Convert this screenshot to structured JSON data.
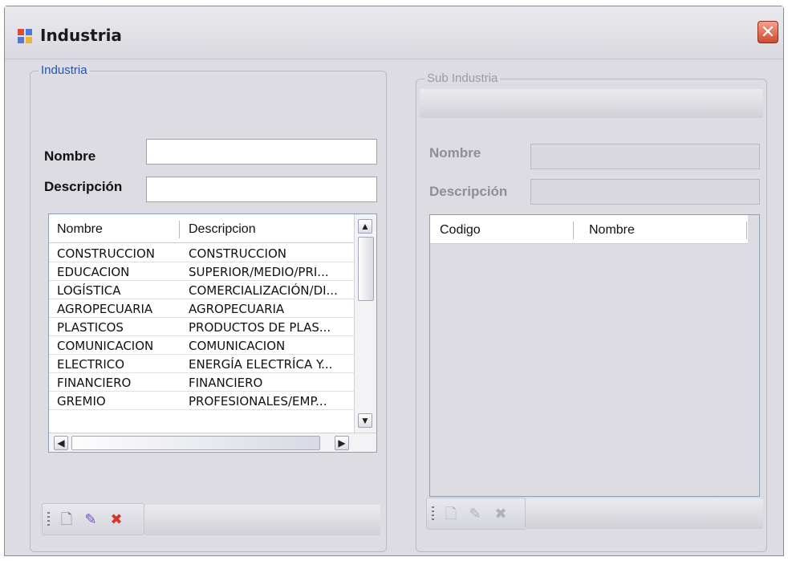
{
  "window": {
    "title": "Industria",
    "close_symbol": "✕"
  },
  "left_group": {
    "legend": "Industria",
    "nombre_label": "Nombre",
    "descripcion_label": "Descripción",
    "nombre_value": "",
    "descripcion_value": "",
    "grid": {
      "columns": [
        "Nombre",
        "Descripcion"
      ],
      "rows": [
        [
          "CONSTRUCCION",
          "CONSTRUCCION"
        ],
        [
          "EDUCACION",
          "SUPERIOR/MEDIO/PRI..."
        ],
        [
          "LOGÍSTICA",
          "COMERCIALIZACIÓN/DI..."
        ],
        [
          "AGROPECUARIA",
          "AGROPECUARIA"
        ],
        [
          "PLASTICOS",
          "PRODUCTOS DE PLAS..."
        ],
        [
          "COMUNICACION",
          "COMUNICACION"
        ],
        [
          "ELECTRICO",
          "ENERGÍA ELECTRÍCA Y..."
        ],
        [
          "FINANCIERO",
          "FINANCIERO"
        ],
        [
          "GREMIO",
          "PROFESIONALES/EMP..."
        ]
      ]
    },
    "toolbar": {
      "new_icon": "new-document-icon",
      "edit_icon": "pencil-icon",
      "delete_icon": "delete-x-icon"
    }
  },
  "right_group": {
    "legend": "Sub Industria",
    "nombre_label": "Nombre",
    "descripcion_label": "Descripción",
    "grid": {
      "columns": [
        "Codigo",
        "Nombre"
      ],
      "rows": []
    }
  },
  "colors": {
    "legend_active": "#1d56b6",
    "legend_disabled": "#9a9aa4",
    "delete": "#d9342b",
    "edit": "#7a4cc9"
  }
}
